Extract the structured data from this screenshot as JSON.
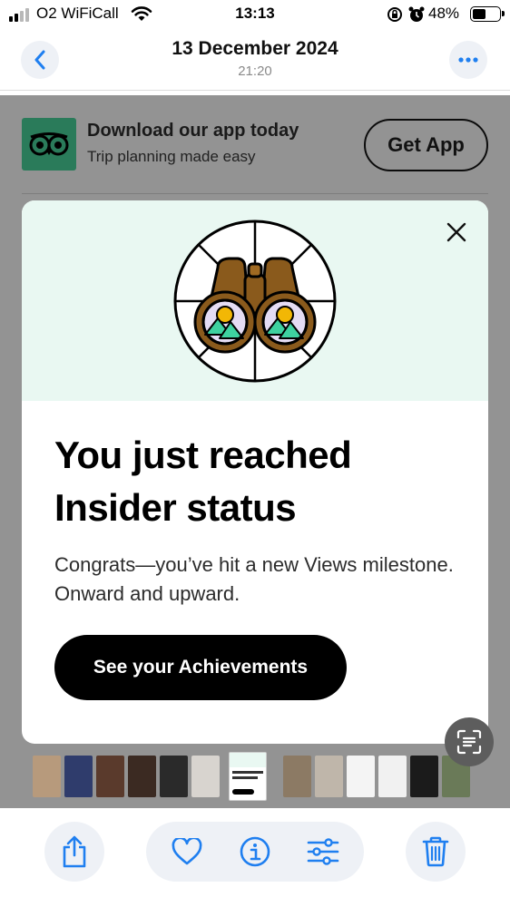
{
  "status_bar": {
    "carrier": "O2 WiFiCall",
    "time": "13:13",
    "battery": "48%",
    "icons": [
      "signal-icon",
      "wifi-icon",
      "orientation-lock-icon",
      "alarm-icon",
      "battery-icon"
    ]
  },
  "photo_header": {
    "date": "13 December 2024",
    "time": "21:20",
    "icons": [
      "chevron-left-icon",
      "more-icon"
    ]
  },
  "screenshot": {
    "app_banner": {
      "title": "Download our app today",
      "subtitle": "Trip planning made easy",
      "button": "Get App",
      "icon": "owl-logo-icon"
    },
    "modal": {
      "title": "You just reached Insider status",
      "body": "Congrats—you’ve hit a new Views milestone. Onward and upward.",
      "cta": "See your Achievements",
      "icons": [
        "close-icon",
        "binoculars-badge-icon"
      ],
      "colors": {
        "hero_bg": "#e9f8f2",
        "badge_green": "#3ed1a0",
        "badge_gold": "#f2b705",
        "binocular_brown": "#8a5a1c"
      }
    }
  },
  "live_text": {
    "icon": "live-text-icon"
  },
  "thumbnail_strip": {
    "thumbnails": [
      {
        "color": "#b79a7c"
      },
      {
        "color": "#2f3c6c"
      },
      {
        "color": "#5a3a2c"
      },
      {
        "color": "#3b2a22"
      },
      {
        "color": "#2a2a2a"
      },
      {
        "color": "#d8d4cf"
      },
      {
        "color": "#ffffff",
        "current": true
      },
      {
        "color": "#8c7a64"
      },
      {
        "color": "#bfb6aa"
      },
      {
        "color": "#f4f4f4"
      },
      {
        "color": "#f1f1f1"
      },
      {
        "color": "#1b1b1b"
      },
      {
        "color": "#6a7a58"
      }
    ]
  },
  "toolbar": {
    "icons": [
      "share-icon",
      "heart-icon",
      "info-icon",
      "adjust-icon",
      "trash-icon"
    ],
    "accent": "#1f7ff0"
  }
}
